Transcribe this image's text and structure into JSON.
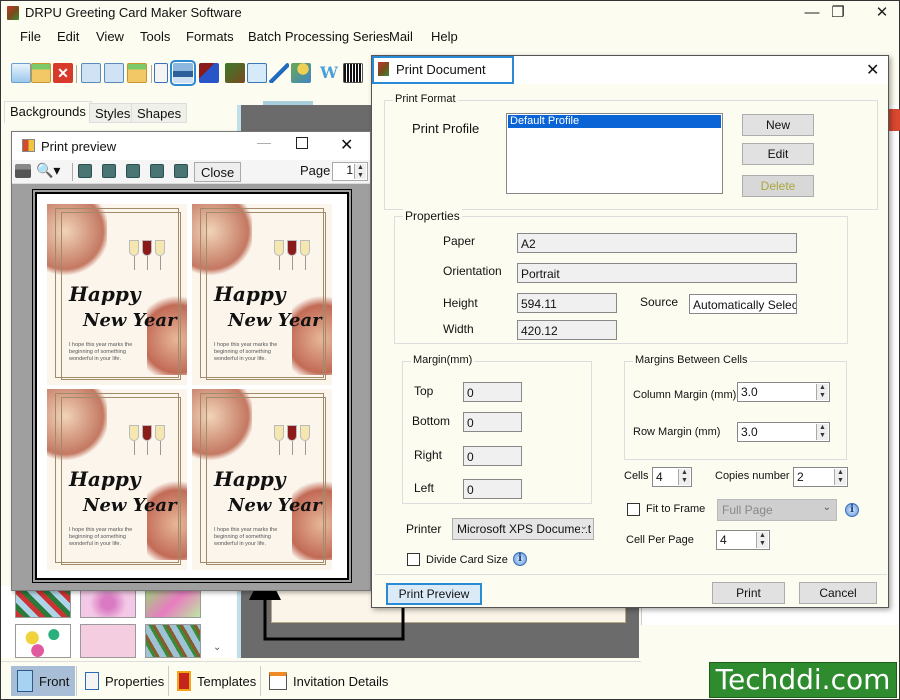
{
  "app": {
    "title": "DRPU Greeting Card Maker Software",
    "window_controls": [
      "minimize",
      "restore",
      "close"
    ]
  },
  "menu": [
    "File",
    "Edit",
    "View",
    "Tools",
    "Formats",
    "Batch Processing Series",
    "Mail",
    "Help"
  ],
  "toolbar": {
    "icons": [
      "new-icon",
      "open-icon",
      "close-doc-icon",
      "save-icon",
      "save-as-icon",
      "open-folder-icon",
      "properties-icon",
      "print-icon",
      "layers-icon",
      "image-icon",
      "insert-image-icon",
      "pen-icon",
      "shapes-icon",
      "wordart-icon",
      "barcode-icon"
    ],
    "highlighted": "print-icon"
  },
  "left_panel": {
    "tabs": [
      "Backgrounds",
      "Styles",
      "Shapes"
    ],
    "active_tab": "Backgrounds"
  },
  "bottom_tabs": [
    {
      "label": "Front",
      "icon": "front-icon",
      "active": true
    },
    {
      "label": "Properties",
      "icon": "properties-icon"
    },
    {
      "label": "Templates",
      "icon": "templates-icon"
    },
    {
      "label": "Invitation Details",
      "icon": "invitation-icon"
    }
  ],
  "print_preview": {
    "title": "Print preview",
    "close_label": "Close",
    "page_label": "Page",
    "page_value": "1",
    "cards": [
      {
        "line1": "Happy",
        "line2": "New Year",
        "message": "I hope this year marks the beginning of something wonderful in your life."
      },
      {
        "line1": "Happy",
        "line2": "New Year",
        "message": "I hope this year marks the beginning of something wonderful in your life."
      },
      {
        "line1": "Happy",
        "line2": "New Year",
        "message": "I hope this year marks the beginning of something wonderful in your life."
      },
      {
        "line1": "Happy",
        "line2": "New Year",
        "message": "I hope this year marks the beginning of something wonderful in your life."
      }
    ]
  },
  "print_document": {
    "title": "Print Document",
    "print_format": {
      "group_label": "Print Format",
      "profile_label": "Print Profile",
      "profiles": [
        "Default Profile"
      ],
      "selected_profile": "Default Profile",
      "new_label": "New",
      "edit_label": "Edit",
      "delete_label": "Delete"
    },
    "properties": {
      "group_label": "Properties",
      "paper_label": "Paper",
      "paper": "A2",
      "orientation_label": "Orientation",
      "orientation": "Portrait",
      "height_label": "Height",
      "height": "594.11",
      "width_label": "Width",
      "width": "420.12",
      "source_label": "Source",
      "source": "Automatically Selec"
    },
    "margin": {
      "group_label": "Margin(mm)",
      "top_label": "Top",
      "top": "0",
      "bottom_label": "Bottom",
      "bottom": "0",
      "right_label": "Right",
      "right": "0",
      "left_label": "Left",
      "left": "0"
    },
    "cell_margins": {
      "group_label": "Margins Between Cells",
      "column_label": "Column Margin (mm)",
      "column": "3.0",
      "row_label": "Row Margin (mm)",
      "row": "3.0"
    },
    "cells_label": "Cells",
    "cells": "4",
    "copies_label": "Copies number",
    "copies": "2",
    "fit_to_frame_label": "Fit to Frame",
    "fit_to_frame_checked": false,
    "fit_mode": "Full Page",
    "cell_per_page_label": "Cell Per Page",
    "cell_per_page": "4",
    "printer_label": "Printer",
    "printer": "Microsoft XPS Document",
    "divide_card_label": "Divide Card Size",
    "divide_card_checked": false,
    "print_preview_label": "Print Preview",
    "print_label": "Print",
    "cancel_label": "Cancel"
  },
  "watermark": "Techddi.com",
  "colors": {
    "highlight": "#2b8ad6",
    "selection": "#0a64d6",
    "watermark_bg": "#2e8b2e"
  }
}
